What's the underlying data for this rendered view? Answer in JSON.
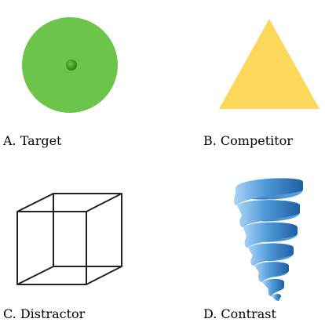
{
  "captions": {
    "a": "A. Target",
    "b": "B. Competitor",
    "c": "C. Distractor",
    "d": "D. Contrast"
  },
  "colors": {
    "target_fill": "#6cc54a",
    "target_dot": "#3f8f27",
    "competitor_fill": "#fcd85a",
    "distractor_stroke": "#222222",
    "contrast_light": "#a9d4f5",
    "contrast_mid": "#4f9ad8",
    "contrast_dark": "#1f5fa3"
  },
  "icons": {
    "a": "green-circle-icon",
    "b": "yellow-triangle-icon",
    "c": "wireframe-cube-icon",
    "d": "blue-spiral-icon"
  }
}
